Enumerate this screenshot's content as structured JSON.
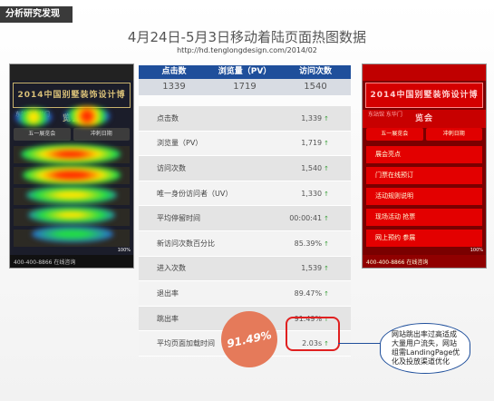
{
  "section_tag": "分析研究发现",
  "title": "4月24日-5月3日移动着陆页面热图数据",
  "url": "http://hd.tenglongdesign.com/2014/02",
  "summary": {
    "headers": [
      "点击数",
      "浏览量（PV）",
      "访问次数"
    ],
    "values": [
      "1339",
      "1719",
      "1540"
    ]
  },
  "stats": [
    {
      "label": "点击数",
      "value": "1,339"
    },
    {
      "label": "浏览量（PV）",
      "value": "1,719"
    },
    {
      "label": "访问次数",
      "value": "1,540"
    },
    {
      "label": "唯一身份访问者（UV）",
      "value": "1,330"
    },
    {
      "label": "平均停留时间",
      "value": "00:00:41"
    },
    {
      "label": "新访问次数百分比",
      "value": "85.39%"
    },
    {
      "label": "进入次数",
      "value": "1,539"
    },
    {
      "label": "退出率",
      "value": "89.47%"
    },
    {
      "label": "跳出率",
      "value": "91.49%"
    },
    {
      "label": "平均页面加载时间",
      "value": "2.03s"
    }
  ],
  "up_arrow": "↑",
  "bounce_badge": "91.49%",
  "callout": "网站跳出率过高适成大量用户流失，网站组需LandingPage优化及投放渠道优化",
  "phone": {
    "banner": "2014中国别墅装饰设计博览会",
    "sub": "东站馆 东华门",
    "buttons": [
      "五一展览会",
      "冲刺日期"
    ],
    "rows": [
      "展会亮点",
      "门票在线预订",
      "活动规则说明",
      "现场活动 抢票",
      "网上预约 参展"
    ],
    "footer": "400-400-8866   在线咨询",
    "badge": "100%",
    "colors": {
      "heat_red": "#ff2a00",
      "heat_yellow": "#ffe600",
      "heat_green": "#22dd44",
      "heat_blue": "#2a4dff"
    }
  }
}
